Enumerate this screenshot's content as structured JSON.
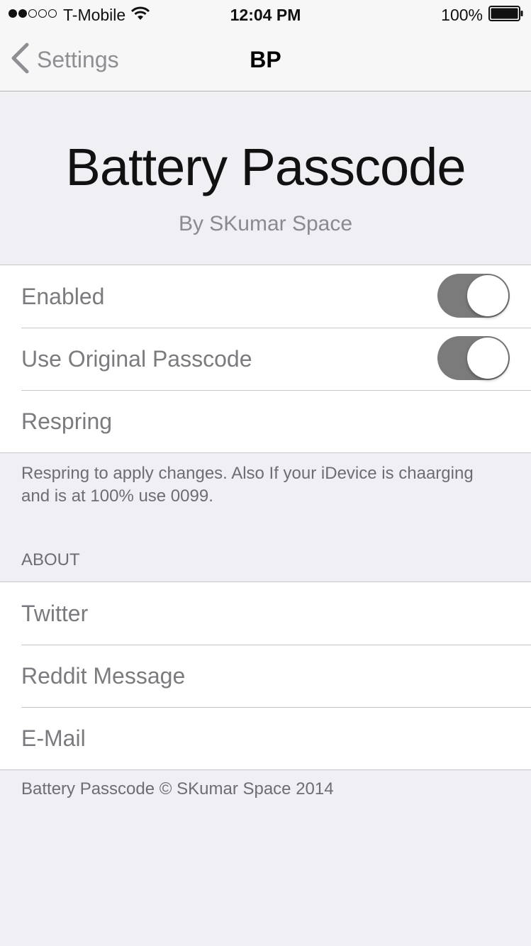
{
  "status_bar": {
    "signal_filled": 2,
    "signal_total": 5,
    "carrier": "T-Mobile",
    "time": "12:04 PM",
    "battery_percent": "100%"
  },
  "nav": {
    "back_label": "Settings",
    "title": "BP"
  },
  "banner": {
    "title": "Battery Passcode",
    "subtitle": "By SKumar Space"
  },
  "settings": {
    "rows": [
      {
        "label": "Enabled",
        "toggle": true,
        "toggle_on": true
      },
      {
        "label": "Use Original Passcode",
        "toggle": true,
        "toggle_on": true
      },
      {
        "label": "Respring"
      }
    ],
    "footer": "Respring to apply changes. Also If your iDevice is chaarging and is at 100% use 0099."
  },
  "about": {
    "header": "ABOUT",
    "rows": [
      {
        "label": "Twitter"
      },
      {
        "label": "Reddit Message"
      },
      {
        "label": "E-Mail"
      }
    ],
    "footer": "Battery Passcode © SKumar Space 2014"
  },
  "colors": {
    "background": "#efeff4",
    "toggle_track": "#7b7b7b",
    "row_text": "#7b7b7f"
  }
}
